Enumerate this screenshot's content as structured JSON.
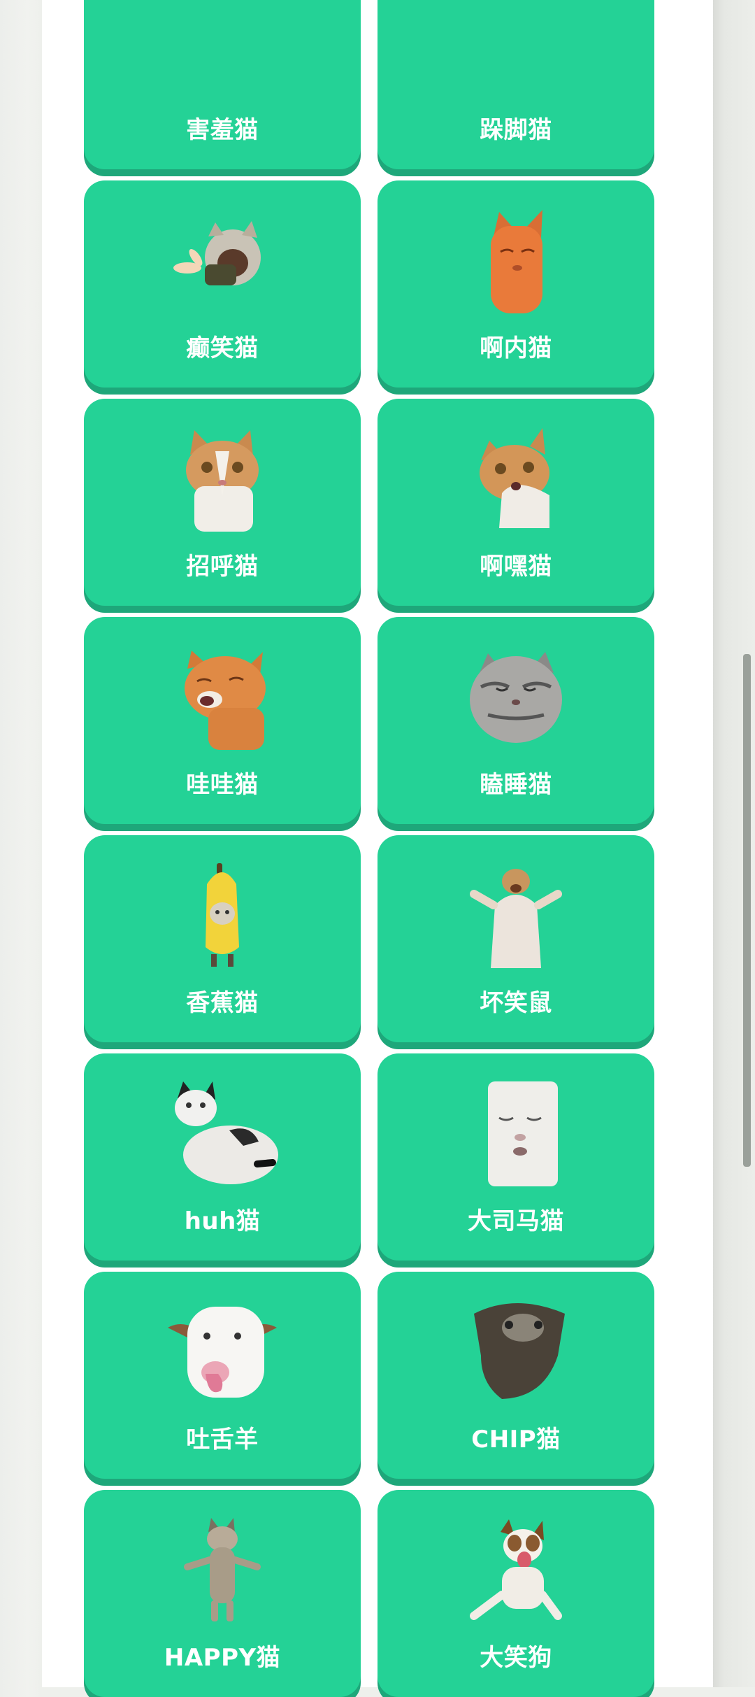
{
  "cards": [
    {
      "label": "害羞猫",
      "image": "shy-cat"
    },
    {
      "label": "跺脚猫",
      "image": "stomping-cat"
    },
    {
      "label": "癫笑猫",
      "image": "crazy-laughing-cat"
    },
    {
      "label": "啊内猫",
      "image": "orange-cat"
    },
    {
      "label": "招呼猫",
      "image": "greeting-cat"
    },
    {
      "label": "啊嘿猫",
      "image": "ahei-cat"
    },
    {
      "label": "哇哇猫",
      "image": "wawa-cat"
    },
    {
      "label": "瞌睡猫",
      "image": "sleepy-cat"
    },
    {
      "label": "香蕉猫",
      "image": "banana-cat"
    },
    {
      "label": "坏笑鼠",
      "image": "smirking-hamster"
    },
    {
      "label": "huh猫",
      "image": "huh-cat"
    },
    {
      "label": "大司马猫",
      "image": "white-cat"
    },
    {
      "label": "吐舌羊",
      "image": "tongue-goat"
    },
    {
      "label": "CHIP猫",
      "image": "chip-cat"
    },
    {
      "label": "HAPPY猫",
      "image": "happy-cat"
    },
    {
      "label": "大笑狗",
      "image": "laughing-dog"
    }
  ]
}
